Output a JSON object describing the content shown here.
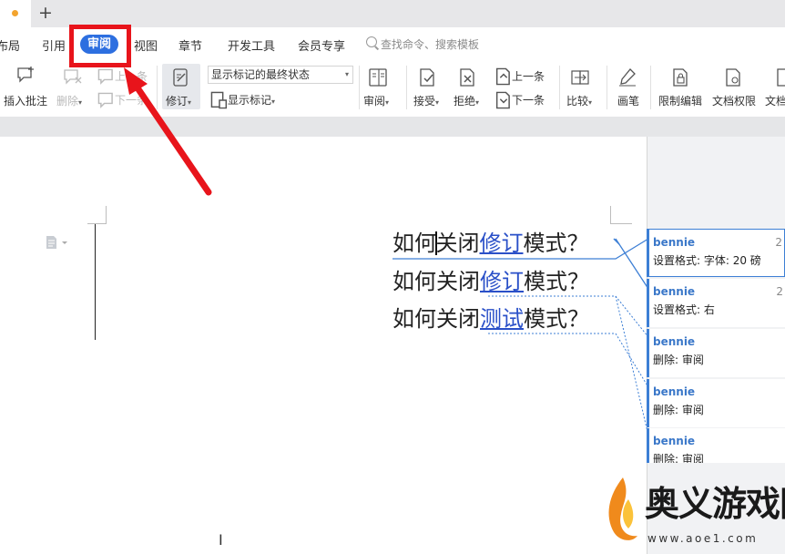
{
  "tabs": {
    "new_tab": "+"
  },
  "menu": {
    "items": [
      "布局",
      "引用",
      "审阅",
      "视图",
      "章节",
      "开发工具",
      "会员专享"
    ],
    "active": "审阅",
    "search_placeholder": "查找命令、搜索模板"
  },
  "toolbar": {
    "insert_comment": "插入批注",
    "delete": "删除",
    "prev_comment": "上一条",
    "next_comment": "下一条",
    "track_changes": "修订",
    "display_mode": "显示标记的最终状态",
    "show_markup": "显示标记",
    "review": "审阅",
    "accept": "接受",
    "reject": "拒绝",
    "prev_change": "上一条",
    "next_change": "下一条",
    "compare": "比较",
    "ink": "画笔",
    "restrict_editing": "限制编辑",
    "document_permissions": "文档权限",
    "cut_off_button": "文档"
  },
  "document": {
    "lines": [
      {
        "before": "如何",
        "mid": "关闭",
        "inserted": "修订",
        "after": "模式？"
      },
      {
        "before": "如何关闭",
        "inserted": "修订",
        "after": "模式？"
      },
      {
        "before": "如何关闭",
        "inserted": "测试",
        "after": "模式？"
      }
    ]
  },
  "comments": [
    {
      "author": "bennie",
      "date": "2",
      "text": "设置格式: 字体: 20 磅"
    },
    {
      "author": "bennie",
      "date": "2",
      "text": "设置格式: 右"
    },
    {
      "author": "bennie",
      "text": "删除: 审阅"
    },
    {
      "author": "bennie",
      "text": "删除: 审阅"
    },
    {
      "author": "bennie",
      "text": "删除: 审阅"
    }
  ],
  "watermark": {
    "name": "奥义游戏网",
    "url": "www.aoe1.com"
  },
  "colors": {
    "accent": "#2d6fe0",
    "highlight": "#e8141b",
    "revision": "#2a50c8",
    "markup_border": "#3d7fd5"
  }
}
